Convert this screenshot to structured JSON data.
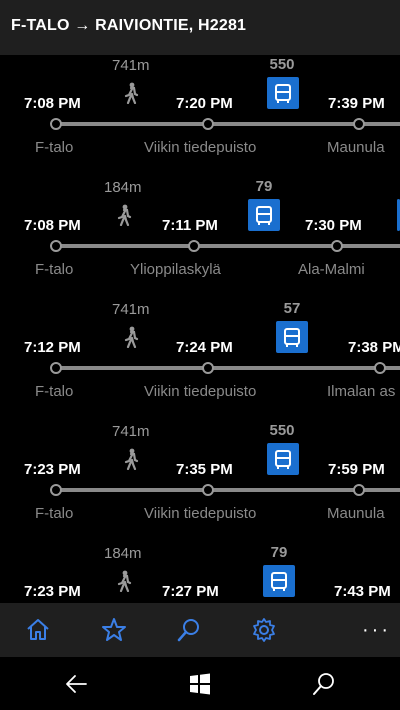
{
  "header": {
    "title": "F-TALO → RAIVIONTIE, H2281"
  },
  "routes": [
    {
      "walk": "741m",
      "line": "550",
      "times": [
        "7:08 PM",
        "7:20 PM",
        "7:39 PM"
      ],
      "stops": [
        "F-talo",
        "Viikin tiedepuisto",
        "Maunula"
      ]
    },
    {
      "walk": "184m",
      "line": "79",
      "times": [
        "7:08 PM",
        "7:11 PM",
        "7:30 PM"
      ],
      "stops": [
        "F-talo",
        "Ylioppilaskylä",
        "Ala-Malmi"
      ]
    },
    {
      "walk": "741m",
      "line": "57",
      "times": [
        "7:12 PM",
        "7:24 PM",
        "7:38 PM"
      ],
      "stops": [
        "F-talo",
        "Viikin tiedepuisto",
        "Ilmalan as"
      ]
    },
    {
      "walk": "741m",
      "line": "550",
      "times": [
        "7:23 PM",
        "7:35 PM",
        "7:59 PM"
      ],
      "stops": [
        "F-talo",
        "Viikin tiedepuisto",
        "Maunula"
      ]
    },
    {
      "walk": "184m",
      "line": "79",
      "times": [
        "7:23 PM",
        "7:27 PM",
        "7:43 PM"
      ],
      "stops": [
        "",
        "",
        ""
      ]
    }
  ],
  "appbar": {
    "icons": [
      "home-icon",
      "star-icon",
      "search-icon",
      "settings-icon"
    ],
    "more": "···"
  },
  "navbar": {
    "icons": [
      "back-icon",
      "windows-icon",
      "search-icon"
    ]
  },
  "colors": {
    "accent": "#1a6fcf",
    "header_bg": "#1f1f1f",
    "line": "#8a8a8a",
    "muted": "#9a9a9a"
  }
}
